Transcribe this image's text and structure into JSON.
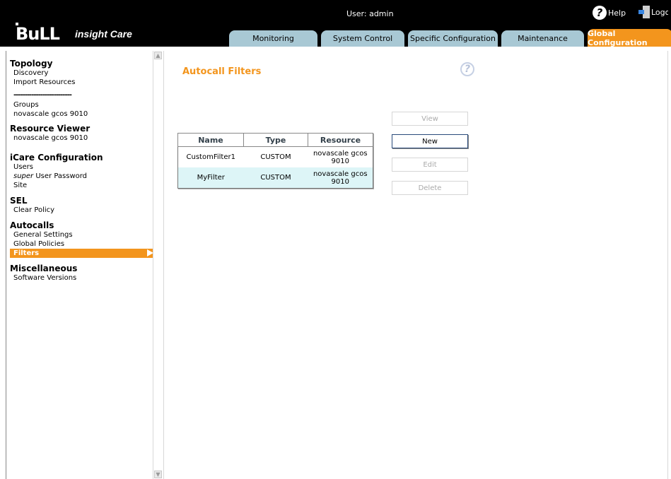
{
  "header": {
    "logo_text": "BuLL",
    "product": "insight Care",
    "user_label": "User: admin",
    "help_label": "Help",
    "logout_label": "Logout"
  },
  "tabs": [
    {
      "label": "Monitoring",
      "active": false
    },
    {
      "label": "System Control",
      "active": false
    },
    {
      "label": "Specific Configuration",
      "active": false
    },
    {
      "label": "Maintenance",
      "active": false
    },
    {
      "label": "Global Configuration",
      "active": true
    }
  ],
  "sidebar": {
    "topology": {
      "title": "Topology",
      "items": [
        "Discovery",
        "Import Resources"
      ],
      "separator": "--------------------------",
      "items2": [
        "Groups",
        "novascale gcos 9010"
      ]
    },
    "resource_viewer": {
      "title": "Resource Viewer",
      "items": [
        "novascale gcos 9010"
      ]
    },
    "icare": {
      "title": "iCare Configuration",
      "users": "Users",
      "super_prefix": "super",
      "super_rest": " User Password",
      "site": "Site"
    },
    "sel": {
      "title": "SEL",
      "items": [
        "Clear Policy"
      ]
    },
    "autocalls": {
      "title": "Autocalls",
      "items": [
        "General Settings",
        "Global Policies"
      ],
      "selected": "Filters"
    },
    "misc": {
      "title": "Miscellaneous",
      "items": [
        "Software Versions"
      ]
    }
  },
  "main": {
    "title": "Autocall Filters",
    "table": {
      "columns": [
        "Name",
        "Type",
        "Resource"
      ],
      "rows": [
        {
          "name": "CustomFilter1",
          "type": "CUSTOM",
          "resource_line1": "novascale gcos",
          "resource_line2": "9010"
        },
        {
          "name": "MyFilter",
          "type": "CUSTOM",
          "resource_line1": "novascale gcos",
          "resource_line2": "9010"
        }
      ]
    },
    "buttons": {
      "view": "View",
      "new": "New",
      "edit": "Edit",
      "delete": "Delete"
    }
  },
  "colors": {
    "accent": "#f3951d",
    "tab": "#a8c8d4",
    "header_bg": "#000000",
    "row_alt": "#ddf5f7"
  }
}
